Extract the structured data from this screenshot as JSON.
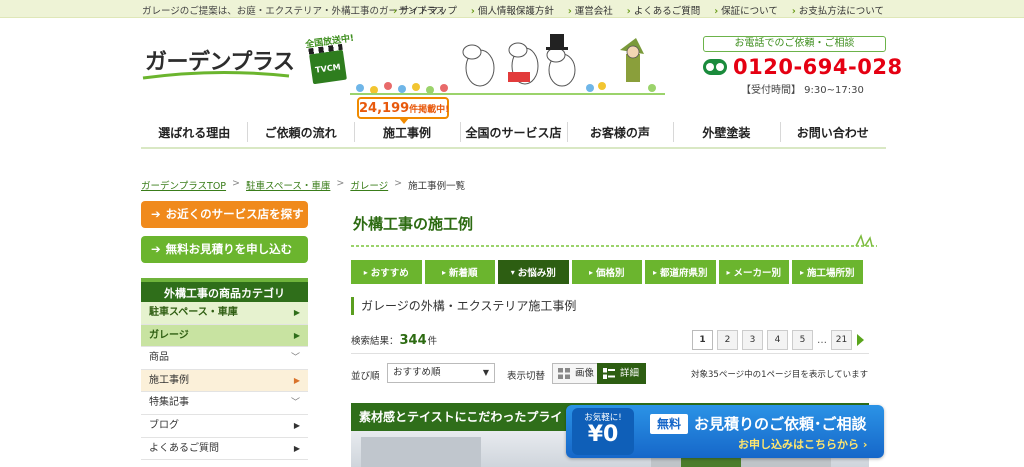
{
  "topbar": {
    "tagline": "ガレージのご提案は、お庭・エクステリア・外構工事のガーデンプラス",
    "links": [
      "サイトマップ",
      "個人情報保護方針",
      "運営会社",
      "よくあるご質問",
      "保証について",
      "お支払方法について"
    ]
  },
  "header": {
    "logo_text": "ガーデンプラス",
    "tvcm_onair": "全国放送中!",
    "tvcm_label": "TVCM",
    "count_number": "24,199",
    "count_suffix": "件掲載中!",
    "contact_label": "お電話でのご依頼・ご相談",
    "phone": "0120-694-028",
    "hours": "【受付時間】 9:30~17:30"
  },
  "nav": [
    "選ばれる理由",
    "ご依頼の流れ",
    "施工事例",
    "全国のサービス店",
    "お客様の声",
    "外壁塗装",
    "お問い合わせ"
  ],
  "breadcrumb": {
    "items": [
      "ガーデンプラスTOP",
      "駐車スペース・車庫",
      "ガレージ"
    ],
    "current": "施工事例一覧"
  },
  "sidebar": {
    "btn_service": "お近くのサービス店を探す",
    "btn_estimate": "無料お見積りを申し込む",
    "category_title": "外構工事の商品カテゴリ",
    "rows": [
      {
        "label": "駐車スペース・車庫"
      },
      {
        "label": "ガレージ"
      },
      {
        "label": "商品"
      },
      {
        "label": "施工事例"
      },
      {
        "label": "特集記事"
      },
      {
        "label": "ブログ"
      },
      {
        "label": "よくあるご質問"
      }
    ]
  },
  "main": {
    "section_title": "外構工事の施工例",
    "tabs": [
      "おすすめ",
      "新着順",
      "お悩み別",
      "価格別",
      "都道府県別",
      "メーカー別",
      "施工場所別"
    ],
    "subheading": "ガレージの外構・エクステリア施工事例",
    "results_prefix": "検索結果：",
    "results_count": "344",
    "results_suffix": "件",
    "pages": [
      "1",
      "2",
      "3",
      "4",
      "5",
      "21"
    ],
    "ellipsis": "…",
    "sort_label": "並び順",
    "sort_value": "おすすめ順",
    "view_label": "表示切替",
    "view_image": "画像",
    "view_detail": "詳細",
    "page_info": "対象35ページ中の1ページ目を表示しています",
    "case_title": "素材感とテイストにこだわったプライ"
  },
  "banner": {
    "small": "お気軽に!",
    "yen": "¥0",
    "free": "無料",
    "title": "お見積りのご依頼･ご相談",
    "cta": "お申し込みはこちらから"
  },
  "colors": {
    "brand_green": "#2f6e1a",
    "accent_green": "#6bb52e",
    "orange": "#f08a1c",
    "phone_red": "#e50012",
    "banner_blue": "#1667c9"
  }
}
